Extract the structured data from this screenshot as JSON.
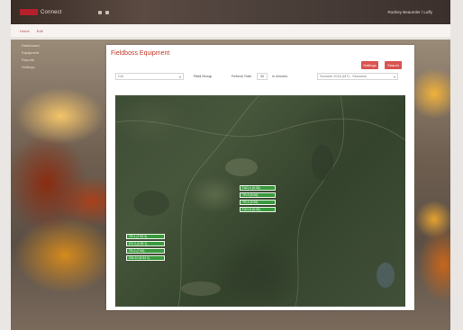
{
  "navbar": {
    "brand": "Connect",
    "user": "Rodney Beaumler / Luffy"
  },
  "breadcrumb": [
    "Home",
    "Edit"
  ],
  "sidebar": {
    "items": [
      "Dashboard",
      "Equipment",
      "Reports",
      "Settings"
    ]
  },
  "panel": {
    "title": "Fieldboss Equipment",
    "buttons": {
      "primary": "Settings",
      "secondary": "Search"
    },
    "toolbar": {
      "course_select": "Ctrl",
      "label_group": "Field Group",
      "label_refresh": "Refresh Rate",
      "refresh_value": "30",
      "label_units": "in minutes",
      "date_select": "Summer 2016 (MT) - Sessions"
    }
  },
  "map": {
    "clusters": [
      {
        "id": "a",
        "markers": [
          "F&G-4 (5:36)",
          "TR-5 (5:36)",
          "TR-4 (5:36)",
          "F&G-8 (5:36)"
        ]
      },
      {
        "id": "b",
        "markers": [
          "TR-1 (7:26 4)",
          "DS-3 (4:36 1)",
          "TR-2 (7:40)",
          "GM-10 (6:54 1)"
        ]
      }
    ]
  },
  "colors": {
    "accent": "#c0392b",
    "button": "#d9534f",
    "marker": "#3a9a3e"
  }
}
